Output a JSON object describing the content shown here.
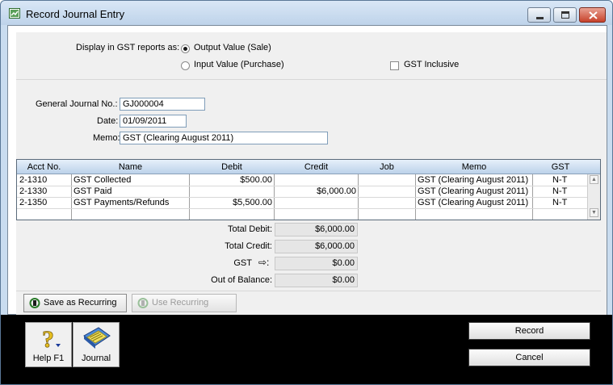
{
  "window": {
    "title": "Record Journal Entry"
  },
  "gst_options": {
    "display_label": "Display in GST reports as:",
    "output_label": "Output Value (Sale)",
    "input_label": "Input Value (Purchase)",
    "selected": "output",
    "inclusive_label": "GST Inclusive",
    "inclusive_checked": false
  },
  "header_fields": {
    "journal_no_label": "General Journal No.:",
    "journal_no_value": "GJ000004",
    "date_label": "Date:",
    "date_value": "01/09/2011",
    "memo_label": "Memo:",
    "memo_value": "GST (Clearing August 2011)"
  },
  "grid": {
    "columns": [
      "Acct No.",
      "Name",
      "Debit",
      "Credit",
      "Job",
      "Memo",
      "GST"
    ],
    "rows": [
      {
        "acct": "2-1310",
        "name": "GST Collected",
        "debit": "$500.00",
        "credit": "",
        "job": "",
        "memo": "GST (Clearing August 2011)",
        "gst": "N-T"
      },
      {
        "acct": "2-1330",
        "name": "GST Paid",
        "debit": "",
        "credit": "$6,000.00",
        "job": "",
        "memo": "GST (Clearing August 2011)",
        "gst": "N-T"
      },
      {
        "acct": "2-1350",
        "name": "GST Payments/Refunds",
        "debit": "$5,500.00",
        "credit": "",
        "job": "",
        "memo": "GST (Clearing August 2011)",
        "gst": "N-T"
      }
    ]
  },
  "totals": {
    "total_debit_label": "Total Debit:",
    "total_debit": "$6,000.00",
    "total_credit_label": "Total Credit:",
    "total_credit": "$6,000.00",
    "gst_label": "GST",
    "gst": "$0.00",
    "out_of_balance_label": "Out of Balance:",
    "out_of_balance": "$0.00"
  },
  "recurring": {
    "save_label": "Save as Recurring",
    "use_label": "Use Recurring"
  },
  "footer": {
    "help_label": "Help F1",
    "journal_label": "Journal",
    "record_label": "Record",
    "cancel_label": "Cancel"
  },
  "colors": {
    "titlebar": "#c9dcef",
    "footer": "#000000",
    "grid_header": "#bcd2ea"
  }
}
